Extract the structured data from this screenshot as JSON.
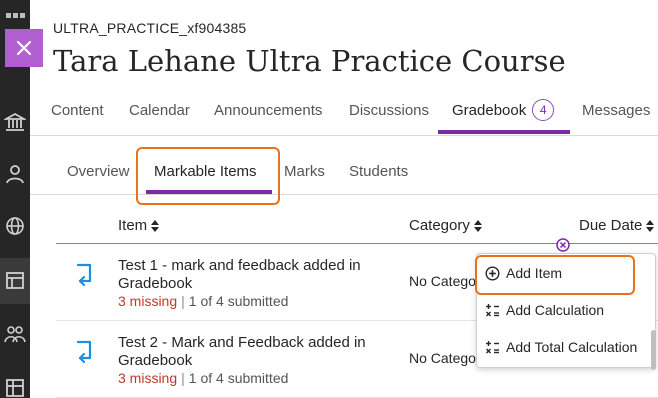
{
  "course": {
    "id": "ULTRA_PRACTICE_xf904385",
    "title": "Tara Lehane Ultra Practice Course"
  },
  "nav_rail": {
    "icons": [
      "grid-icon",
      "institution-icon",
      "person-icon",
      "globe-icon",
      "calendar-icon",
      "groups-icon",
      "grades-icon"
    ]
  },
  "top_tabs": [
    {
      "label": "Content"
    },
    {
      "label": "Calendar"
    },
    {
      "label": "Announcements"
    },
    {
      "label": "Discussions"
    },
    {
      "label": "Gradebook",
      "badge": "4",
      "active": true
    },
    {
      "label": "Messages"
    }
  ],
  "sub_tabs": [
    {
      "label": "Overview"
    },
    {
      "label": "Markable Items",
      "active": true
    },
    {
      "label": "Marks"
    },
    {
      "label": "Students"
    }
  ],
  "table": {
    "columns": [
      "Item",
      "Category",
      "Due Date"
    ],
    "rows": [
      {
        "title": "Test 1 - mark and feedback added in Gradebook",
        "missing": "3 missing",
        "submitted": "1 of 4 submitted",
        "category": "No Category"
      },
      {
        "title": "Test 2 - Mark and Feedback added in Gradebook",
        "missing": "3 missing",
        "submitted": "1 of 4 submitted",
        "category": "No Category"
      }
    ]
  },
  "add_menu": {
    "items": [
      {
        "label": "Add Item",
        "icon": "plus-circle-icon"
      },
      {
        "label": "Add Calculation",
        "icon": "calculation-icon"
      },
      {
        "label": "Add Total Calculation",
        "icon": "total-calculation-icon"
      }
    ]
  },
  "colors": {
    "accent": "#7b2ba3",
    "close_button": "#b15ed1",
    "highlight": "#e8721c",
    "missing": "#c0392b",
    "rail": "#262626"
  }
}
